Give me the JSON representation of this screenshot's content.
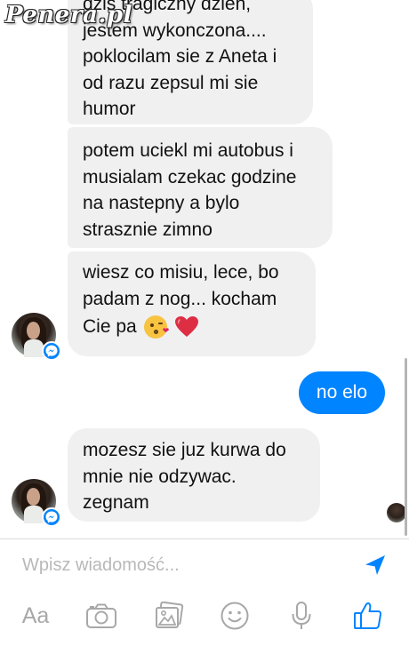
{
  "watermark": "Penera.pl",
  "messages": [
    {
      "from": "contact",
      "lines": [
        "dzis tragiczny dzien,",
        "jestem wykonczona....",
        "poklocilam sie z Aneta i",
        "od razu zepsul mi sie",
        "humor"
      ]
    },
    {
      "from": "contact",
      "lines": [
        "potem uciekl mi autobus i",
        "musialam czekac godzine",
        "na nastepny a bylo",
        "strasznie zimno"
      ]
    },
    {
      "from": "contact",
      "lines": [
        "wiesz co misiu, lece, bo",
        "padam z nog... kocham",
        "Cie pa"
      ],
      "emojis": [
        "kissing-face-emoji",
        "red-heart-emoji"
      ]
    },
    {
      "from": "me",
      "text": "no elo"
    },
    {
      "from": "contact",
      "lines": [
        "mozesz sie juz kurwa do",
        "mnie nie odzywac.",
        "zegnam"
      ]
    }
  ],
  "composer": {
    "placeholder": "Wpisz wiadomość...",
    "send_icon": "send-arrow-icon",
    "tools": [
      {
        "name": "text-format",
        "label": "Aa"
      },
      {
        "name": "camera-icon"
      },
      {
        "name": "gallery-icon"
      },
      {
        "name": "emoji-icon"
      },
      {
        "name": "microphone-icon"
      },
      {
        "name": "like-icon"
      }
    ]
  },
  "colors": {
    "accent": "#0084ff",
    "incoming_bubble": "#f1f0f0",
    "icon_gray": "#a8a8a8"
  }
}
